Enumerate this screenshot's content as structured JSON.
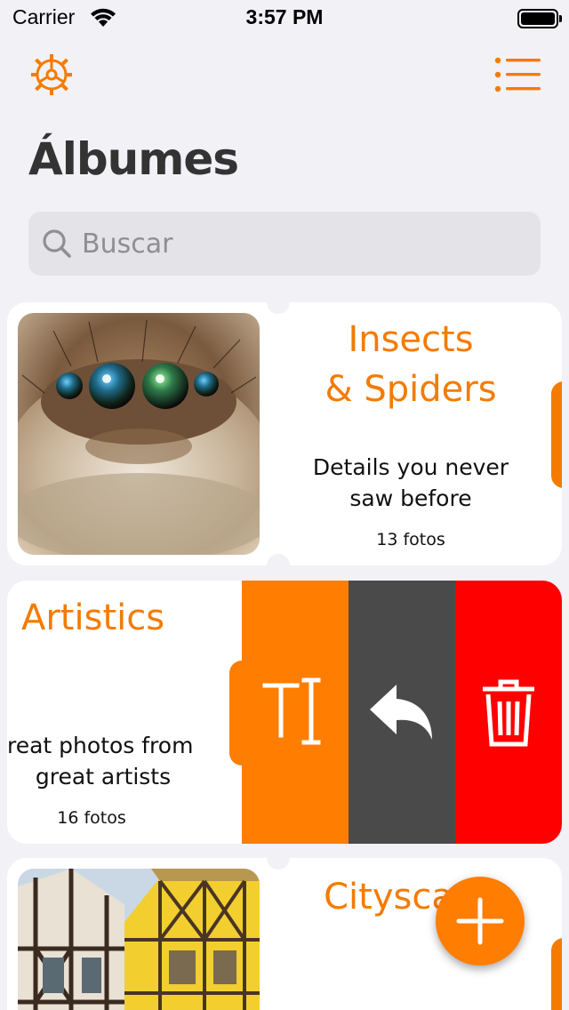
{
  "status_bar": {
    "carrier": "Carrier",
    "time": "3:57 PM"
  },
  "nav": {
    "settings_icon": "gear-icon",
    "list_icon": "list-icon"
  },
  "page": {
    "title": "Álbumes"
  },
  "search": {
    "placeholder": "Buscar"
  },
  "albums": [
    {
      "title_line1": "Insects",
      "title_line2": "& Spiders",
      "desc_line1": "Details you never",
      "desc_line2": "saw before",
      "count": "13 fotos"
    },
    {
      "title_line1": "Artistics",
      "desc_line1": "reat photos from",
      "desc_line2": "great artists",
      "count": "16 fotos"
    },
    {
      "title_line1": "Cityscape"
    }
  ],
  "swipe_actions": {
    "rename_icon": "text-cursor-icon",
    "share_icon": "reply-icon",
    "delete_icon": "trash-icon"
  },
  "fab": {
    "icon": "plus-icon"
  },
  "colors": {
    "accent": "#f47b00",
    "delete": "#ff0000",
    "share": "#4a4a4a",
    "background": "#f2f1f6"
  }
}
